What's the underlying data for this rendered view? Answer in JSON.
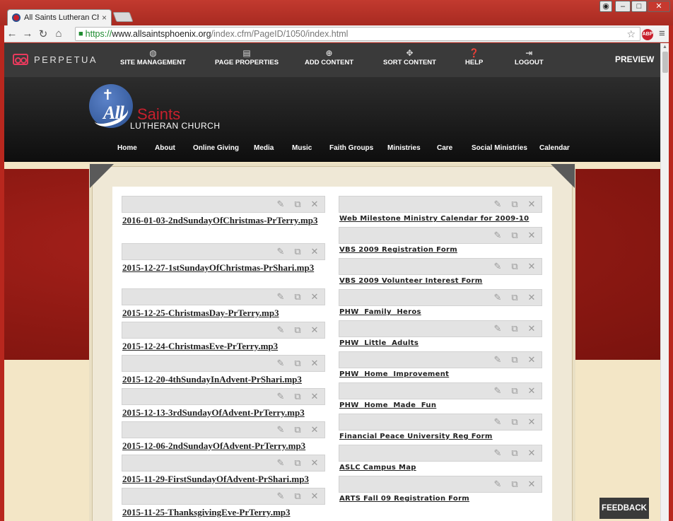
{
  "browser": {
    "tab_title": "All Saints Lutheran Church",
    "tab_close": "×",
    "url_secure": "https://",
    "url_host": "www.allsaintsphoenix.org",
    "url_path": "/index.cfm/PageID/1050/index.html",
    "abp_label": "ABP"
  },
  "admin_bar": {
    "brand": "PERPETUA",
    "items": [
      {
        "label": "SITE MANAGEMENT",
        "icon": "globe-icon",
        "glyph": "◍"
      },
      {
        "label": "PAGE PROPERTIES",
        "icon": "document-icon",
        "glyph": "▤"
      },
      {
        "label": "ADD CONTENT",
        "icon": "plus-circle-icon",
        "glyph": "⊕"
      },
      {
        "label": "SORT CONTENT",
        "icon": "move-icon",
        "glyph": "✥"
      },
      {
        "label": "HELP",
        "icon": "help-icon",
        "glyph": "❓"
      },
      {
        "label": "LOGOUT",
        "icon": "logout-icon",
        "glyph": "⇥"
      }
    ],
    "preview": "PREVIEW"
  },
  "logo": {
    "all": "All",
    "saints": "Saints",
    "sub": "LUTHERAN CHURCH"
  },
  "site_nav": [
    "Home",
    "About",
    "Online Giving",
    "Media",
    "Music",
    "Faith Groups",
    "Ministries",
    "Care",
    "Social Ministries",
    "Calendar"
  ],
  "left_files": [
    "2016-01-03-2ndSundayOfChristmas-PrTerry.mp3",
    "2015-12-27-1stSundayOfChristmas-PrShari.mp3",
    "2015-12-25-ChristmasDay-PrTerry.mp3",
    "2015-12-24-ChristmasEve-PrTerry.mp3",
    "2015-12-20-4thSundayInAdvent-PrShari.mp3",
    "2015-12-13-3rdSundayOfAdvent-PrTerry.mp3",
    "2015-12-06-2ndSundayOfAdvent-PrTerry.mp3",
    "2015-11-29-FirstSundayOfAdvent-PrShari.mp3",
    "2015-11-25-ThanksgivingEve-PrTerry.mp3"
  ],
  "right_files": [
    "Web Milestone Ministry Calendar for 2009-10",
    "VBS 2009 Registration Form",
    "VBS 2009 Volunteer Interest Form",
    "PHW  Family  Heros",
    "PHW  Little  Adults",
    "PHW  Home  Improvement",
    "PHW  Home  Made  Fun",
    "Financial Peace University Reg Form",
    "ASLC Campus Map",
    "ARTS Fall 09 Registration Form"
  ],
  "tool_glyphs": {
    "edit": "✎",
    "copy": "⧉",
    "delete": "✕"
  },
  "feedback": "FEEDBACK"
}
